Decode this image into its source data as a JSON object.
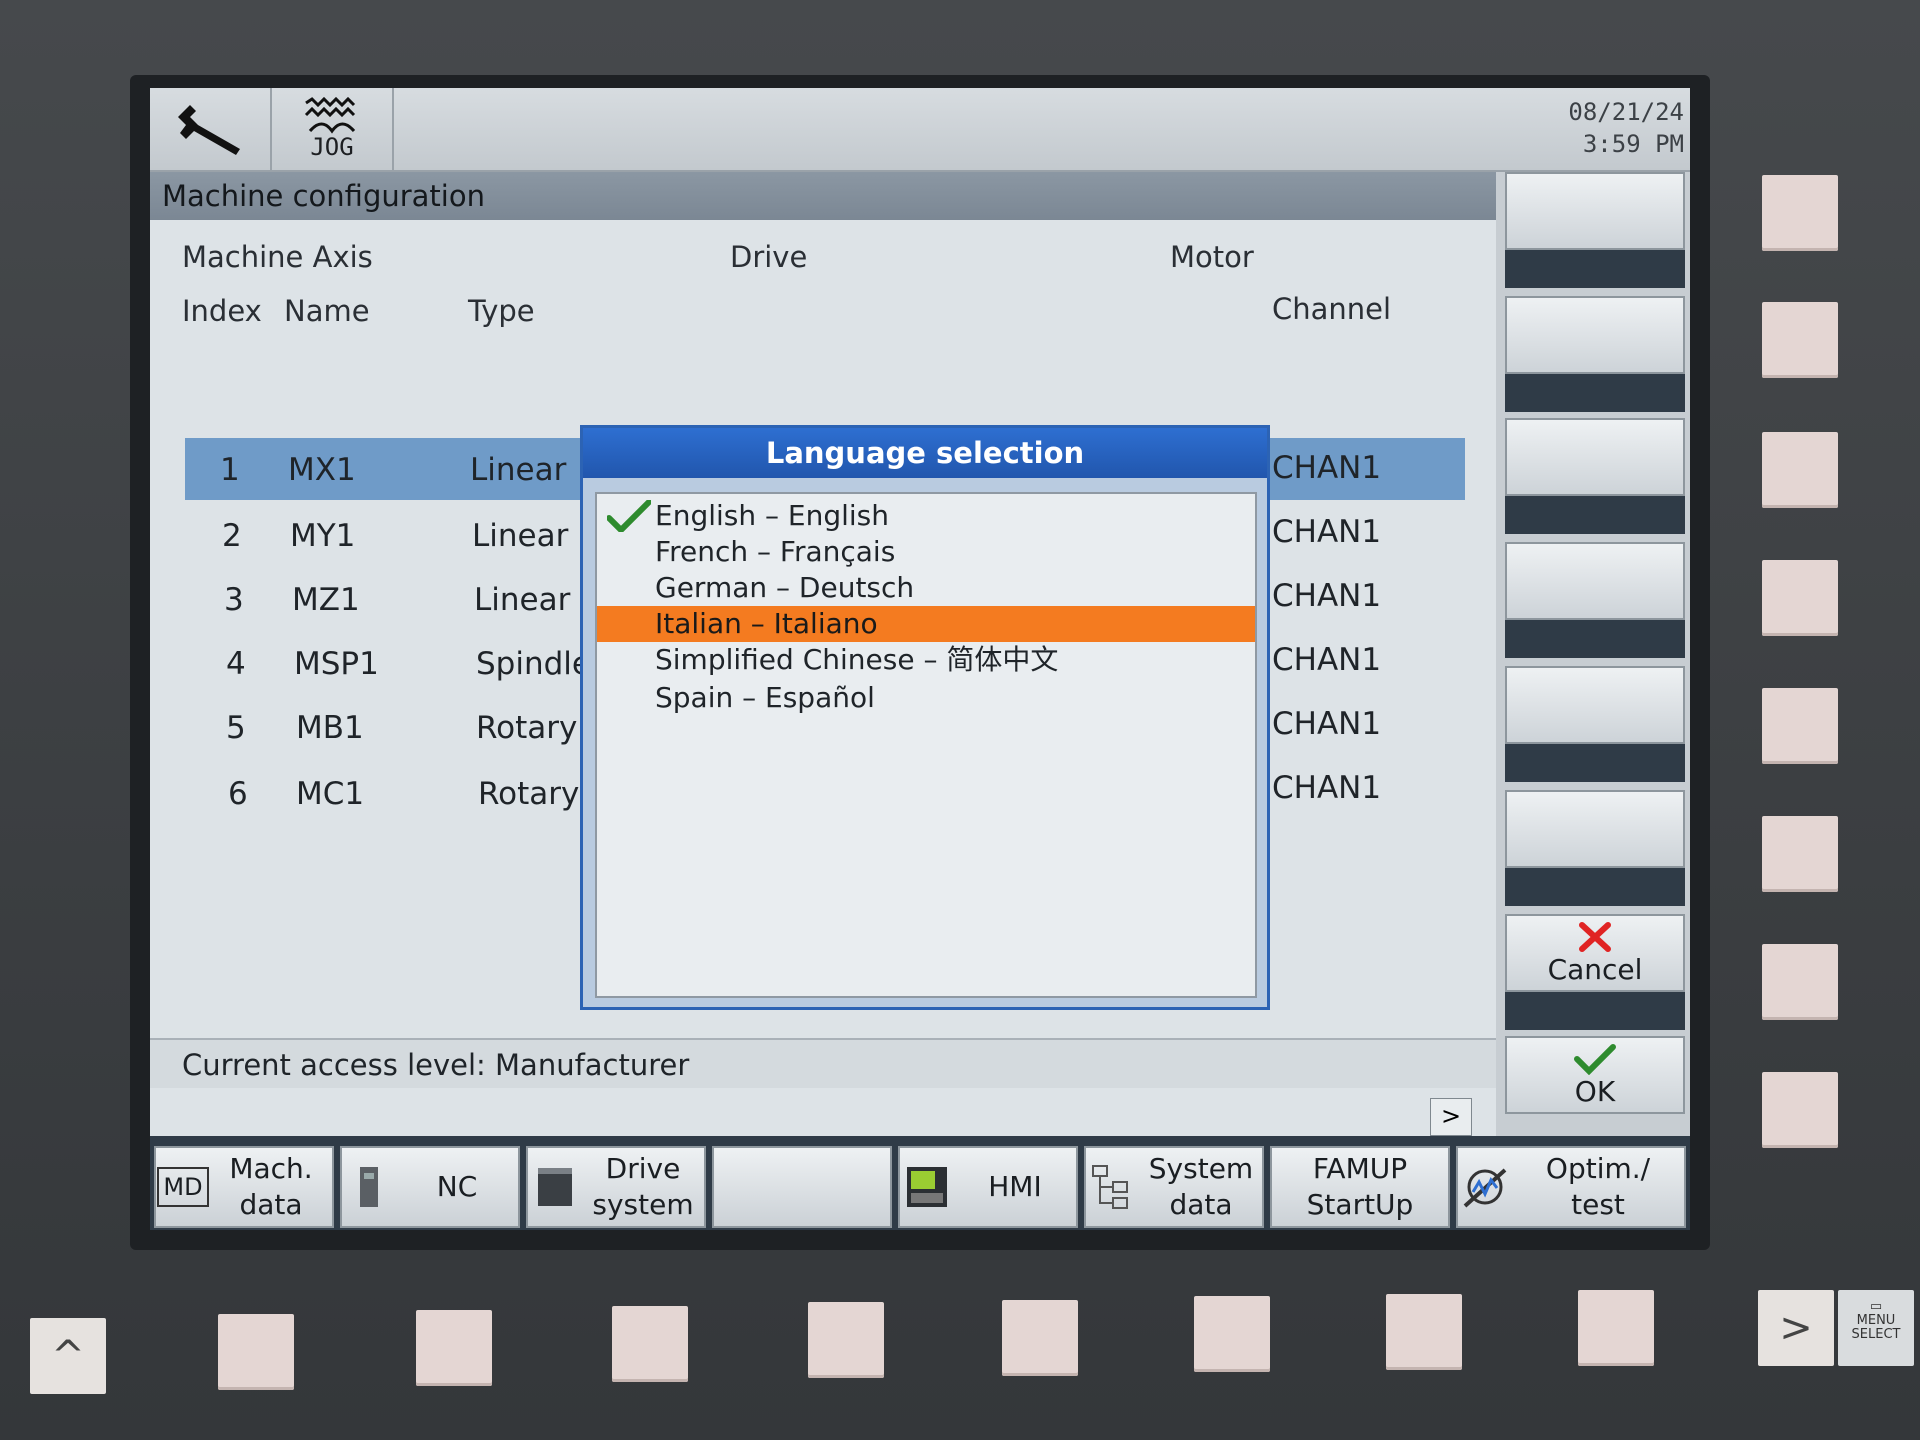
{
  "header": {
    "jog_label": "JOG",
    "date": "08/21/24",
    "time": "3:59 PM",
    "icons": [
      "wrench-icon",
      "jog-mode-icon"
    ]
  },
  "window": {
    "title": "Machine configuration",
    "group_headers": {
      "machine_axis": "Machine Axis",
      "drive": "Drive",
      "motor": "Motor"
    },
    "column_headers": {
      "index": "Index",
      "name": "Name",
      "type": "Type",
      "channel": "Channel"
    },
    "rows": [
      {
        "index": "1",
        "name": "MX1",
        "type": "Linear",
        "channel": "CHAN1"
      },
      {
        "index": "2",
        "name": "MY1",
        "type": "Linear",
        "channel": "CHAN1"
      },
      {
        "index": "3",
        "name": "MZ1",
        "type": "Linear",
        "channel": "CHAN1"
      },
      {
        "index": "4",
        "name": "MSP1",
        "type": "Spindle",
        "channel": "CHAN1"
      },
      {
        "index": "5",
        "name": "MB1",
        "type": "Rotary",
        "channel": "CHAN1"
      },
      {
        "index": "6",
        "name": "MC1",
        "type": "Rotary",
        "channel": "CHAN1"
      }
    ],
    "status": "Current access level: Manufacturer",
    "more_button": ">"
  },
  "dialog": {
    "title": "Language selection",
    "languages": [
      "English – English",
      "French – Français",
      "German – Deutsch",
      "Italian – Italiano",
      "Simplified Chinese – 简体中文",
      "Spain – Español"
    ],
    "checked": "English – English",
    "highlighted": "Italian – Italiano"
  },
  "right_softkeys": {
    "cancel": "Cancel",
    "ok": "OK"
  },
  "bottom_softkeys": {
    "mach_data_1": "Mach.",
    "mach_data_2": "data",
    "md_icon_text": "MD",
    "nc": "NC",
    "drive_system_1": "Drive",
    "drive_system_2": "system",
    "hmi": "HMI",
    "system_data_1": "System",
    "system_data_2": "data",
    "famup_1": "FAMUP",
    "famup_2": "StartUp",
    "optim_1": "Optim./",
    "optim_2": "test"
  },
  "hardware": {
    "up_key": "^",
    "next_key": ">",
    "menu_select_1": "MENU",
    "menu_select_2": "SELECT"
  },
  "colors": {
    "selection_row": "#6f9bc8",
    "dialog_title_bar": "#2156ad",
    "highlight": "#f47b20",
    "cancel_x": "#e02424",
    "ok_check": "#2e8b2e"
  }
}
